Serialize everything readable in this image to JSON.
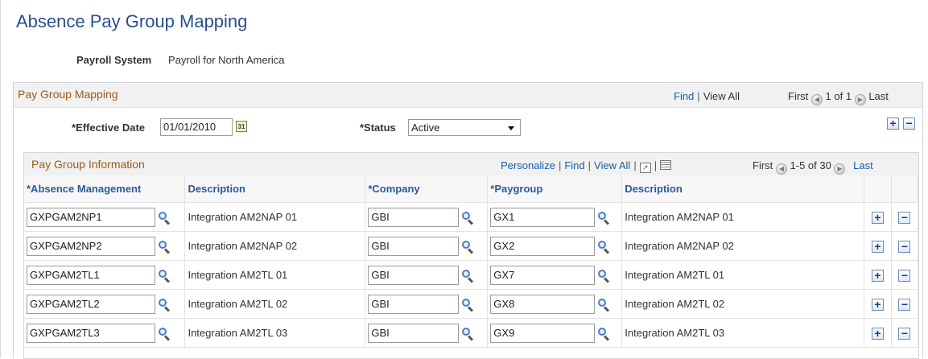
{
  "page": {
    "title": "Absence Pay Group Mapping",
    "payroll_system_label": "Payroll System",
    "payroll_system_value": "Payroll for North America"
  },
  "outer": {
    "title": "Pay Group Mapping",
    "find": "Find",
    "view_all": "View All",
    "first": "First",
    "range": "1 of 1",
    "last": "Last",
    "effective_date_label": "*Effective Date",
    "effective_date_value": "01/01/2010",
    "status_label": "*Status",
    "status_value": "Active",
    "add": "+",
    "remove": "−"
  },
  "grid": {
    "title": "Pay Group Information",
    "personalize": "Personalize",
    "find": "Find",
    "view_all": "View All",
    "first": "First",
    "range": "1-5 of 30",
    "last": "Last",
    "columns": [
      "*Absence Management",
      "Description",
      "*Company",
      "*Paygroup",
      "Description"
    ],
    "rows": [
      {
        "absence": "GXPGAM2NP1",
        "desc": "Integration AM2NAP 01",
        "company": "GBI",
        "paygroup": "GX1",
        "pg_desc": "Integration AM2NAP 01"
      },
      {
        "absence": "GXPGAM2NP2",
        "desc": "Integration AM2NAP 02",
        "company": "GBI",
        "paygroup": "GX2",
        "pg_desc": "Integration AM2NAP 02"
      },
      {
        "absence": "GXPGAM2TL1",
        "desc": "Integration AM2TL 01",
        "company": "GBI",
        "paygroup": "GX7",
        "pg_desc": "Integration AM2TL 01"
      },
      {
        "absence": "GXPGAM2TL2",
        "desc": "Integration AM2TL 02",
        "company": "GBI",
        "paygroup": "GX8",
        "pg_desc": "Integration AM2TL 02"
      },
      {
        "absence": "GXPGAM2TL3",
        "desc": "Integration AM2TL 03",
        "company": "GBI",
        "paygroup": "GX9",
        "pg_desc": "Integration AM2TL 03"
      }
    ],
    "add": "+",
    "remove": "−"
  },
  "icons": {
    "calendar": "calendar-icon",
    "lookup": "lookup-icon",
    "prev": "previous-arrow-icon",
    "next": "next-arrow-icon",
    "zoom": "zoom-icon",
    "download": "download-grid-icon"
  }
}
